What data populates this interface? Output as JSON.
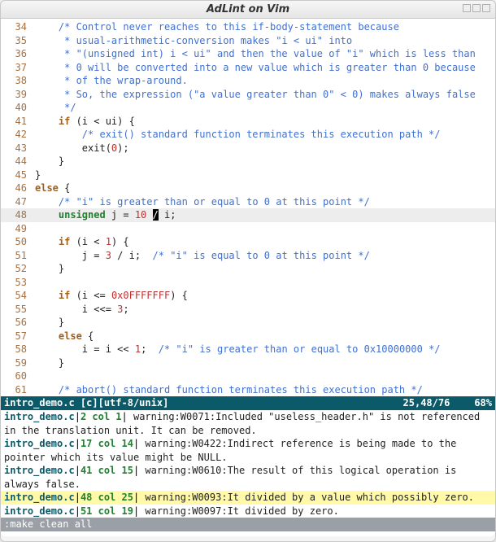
{
  "window": {
    "title": "AdLint on Vim"
  },
  "editor": {
    "first_line": 34,
    "highlight_line": 48,
    "cursor": {
      "line": 48,
      "ch_before": "unsigned j = 10 ",
      "ch": "/",
      "ch_after": " i;"
    },
    "lines": [
      {
        "n": 34,
        "segs": [
          {
            "t": "    ",
            "c": ""
          },
          {
            "t": "/* Control never reaches to this if-body-statement because",
            "c": "tok-comment"
          }
        ]
      },
      {
        "n": 35,
        "segs": [
          {
            "t": "     ",
            "c": ""
          },
          {
            "t": "* usual-arithmetic-conversion makes \"i < ui\" into",
            "c": "tok-comment"
          }
        ]
      },
      {
        "n": 36,
        "segs": [
          {
            "t": "     ",
            "c": ""
          },
          {
            "t": "* \"(unsigned int) i < ui\" and then the value of \"i\" which is less than",
            "c": "tok-comment"
          }
        ]
      },
      {
        "n": 37,
        "segs": [
          {
            "t": "     ",
            "c": ""
          },
          {
            "t": "* 0 will be converted into a new value which is greater than 0 because",
            "c": "tok-comment"
          }
        ]
      },
      {
        "n": 38,
        "segs": [
          {
            "t": "     ",
            "c": ""
          },
          {
            "t": "* of the wrap-around.",
            "c": "tok-comment"
          }
        ]
      },
      {
        "n": 39,
        "segs": [
          {
            "t": "     ",
            "c": ""
          },
          {
            "t": "* So, the expression (\"a value greater than 0\" < 0) makes always false",
            "c": "tok-comment"
          }
        ]
      },
      {
        "n": 40,
        "segs": [
          {
            "t": "     ",
            "c": ""
          },
          {
            "t": "*/",
            "c": "tok-comment"
          }
        ]
      },
      {
        "n": 41,
        "segs": [
          {
            "t": "    ",
            "c": ""
          },
          {
            "t": "if",
            "c": "tok-keyword"
          },
          {
            "t": " (i < ui) {",
            "c": ""
          }
        ]
      },
      {
        "n": 42,
        "segs": [
          {
            "t": "        ",
            "c": ""
          },
          {
            "t": "/* exit() standard function terminates this execution path */",
            "c": "tok-comment"
          }
        ]
      },
      {
        "n": 43,
        "segs": [
          {
            "t": "        exit(",
            "c": ""
          },
          {
            "t": "0",
            "c": "tok-number"
          },
          {
            "t": ");",
            "c": ""
          }
        ]
      },
      {
        "n": 44,
        "segs": [
          {
            "t": "    }",
            "c": ""
          }
        ]
      },
      {
        "n": 45,
        "segs": [
          {
            "t": "}",
            "c": ""
          }
        ]
      },
      {
        "n": 46,
        "segs": [
          {
            "t": "",
            "c": ""
          },
          {
            "t": "else",
            "c": "tok-keyword"
          },
          {
            "t": " {",
            "c": ""
          }
        ]
      },
      {
        "n": 47,
        "segs": [
          {
            "t": "    ",
            "c": ""
          },
          {
            "t": "/* \"i\" is greater than or equal to 0 at this point */",
            "c": "tok-comment"
          }
        ]
      },
      {
        "n": 48,
        "segs": []
      },
      {
        "n": 49,
        "segs": [
          {
            "t": " ",
            "c": ""
          }
        ]
      },
      {
        "n": 50,
        "segs": [
          {
            "t": "    ",
            "c": ""
          },
          {
            "t": "if",
            "c": "tok-keyword"
          },
          {
            "t": " (i < ",
            "c": ""
          },
          {
            "t": "1",
            "c": "tok-number"
          },
          {
            "t": ") {",
            "c": ""
          }
        ]
      },
      {
        "n": 51,
        "segs": [
          {
            "t": "        j = ",
            "c": ""
          },
          {
            "t": "3",
            "c": "tok-number"
          },
          {
            "t": " / i;  ",
            "c": ""
          },
          {
            "t": "/* \"i\" is equal to 0 at this point */",
            "c": "tok-comment"
          }
        ]
      },
      {
        "n": 52,
        "segs": [
          {
            "t": "    }",
            "c": ""
          }
        ]
      },
      {
        "n": 53,
        "segs": [
          {
            "t": " ",
            "c": ""
          }
        ]
      },
      {
        "n": 54,
        "segs": [
          {
            "t": "    ",
            "c": ""
          },
          {
            "t": "if",
            "c": "tok-keyword"
          },
          {
            "t": " (i <= ",
            "c": ""
          },
          {
            "t": "0x0FFFFFFF",
            "c": "tok-number"
          },
          {
            "t": ") {",
            "c": ""
          }
        ]
      },
      {
        "n": 55,
        "segs": [
          {
            "t": "        i <<= ",
            "c": ""
          },
          {
            "t": "3",
            "c": "tok-number"
          },
          {
            "t": ";",
            "c": ""
          }
        ]
      },
      {
        "n": 56,
        "segs": [
          {
            "t": "    }",
            "c": ""
          }
        ]
      },
      {
        "n": 57,
        "segs": [
          {
            "t": "    ",
            "c": ""
          },
          {
            "t": "else",
            "c": "tok-keyword"
          },
          {
            "t": " {",
            "c": ""
          }
        ]
      },
      {
        "n": 58,
        "segs": [
          {
            "t": "        i = i << ",
            "c": ""
          },
          {
            "t": "1",
            "c": "tok-number"
          },
          {
            "t": ";  ",
            "c": ""
          },
          {
            "t": "/* \"i\" is greater than or equal to 0x10000000 */",
            "c": "tok-comment"
          }
        ]
      },
      {
        "n": 59,
        "segs": [
          {
            "t": "    }",
            "c": ""
          }
        ]
      },
      {
        "n": 60,
        "segs": [
          {
            "t": " ",
            "c": ""
          }
        ]
      },
      {
        "n": 61,
        "segs": [
          {
            "t": "    ",
            "c": ""
          },
          {
            "t": "/* abort() standard function terminates this execution path */",
            "c": "tok-comment"
          }
        ]
      }
    ],
    "hl_segs_pre": [
      {
        "t": "    ",
        "c": ""
      },
      {
        "t": "unsigned",
        "c": "tok-type"
      },
      {
        "t": " j = ",
        "c": ""
      },
      {
        "t": "10",
        "c": "tok-number"
      },
      {
        "t": " ",
        "c": ""
      }
    ],
    "hl_cursor": "/",
    "hl_segs_post": [
      {
        "t": " i;",
        "c": ""
      }
    ]
  },
  "status": {
    "left": "intro_demo.c [c][utf-8/unix]",
    "pos": "25,48/76",
    "pct": "68%"
  },
  "messages": [
    {
      "file": "intro_demo.c",
      "loc": "2 col 1",
      "text": " warning:W0071:Included \"useless_header.h\" is not referenced in the translation unit. It can be removed.",
      "hl": false
    },
    {
      "file": "intro_demo.c",
      "loc": "17 col 14",
      "text": " warning:W0422:Indirect reference is being made to the pointer which its value might be NULL.",
      "hl": false
    },
    {
      "file": "intro_demo.c",
      "loc": "41 col 15",
      "text": " warning:W0610:The result of this logical operation is always false.",
      "hl": false
    },
    {
      "file": "intro_demo.c",
      "loc": "48 col 25",
      "text": " warning:W0093:It divided by a value which possibly zero.",
      "hl": true
    },
    {
      "file": "intro_demo.c",
      "loc": "51 col 19",
      "text": " warning:W0097:It divided by zero.",
      "hl": false
    }
  ],
  "cmdline": ":make clean all"
}
